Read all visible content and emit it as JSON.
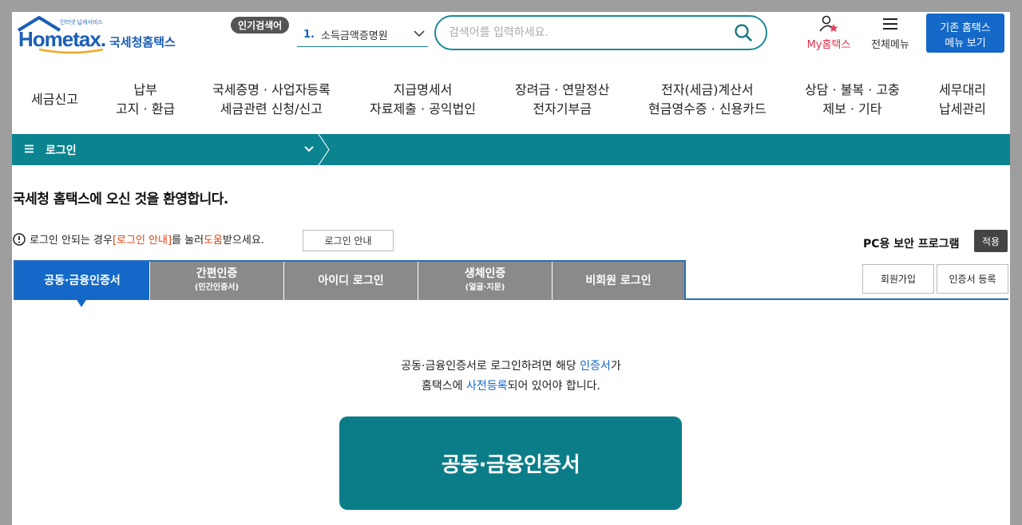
{
  "header": {
    "logo_small": "인터넷 납세서비스",
    "logo_main": "Hometax.",
    "logo_kor": "국세청홈택스",
    "popular_badge": "인기검색어",
    "popular_rank": "1.",
    "popular_term": "소득금액증명원",
    "search_placeholder": "검색어를 입력하세요.",
    "my_hometax": "My홈택스",
    "all_menu": "전체메뉴",
    "old_hometax_line1": "기존 홈택스",
    "old_hometax_line2": "메뉴 보기"
  },
  "gnb": [
    {
      "line1": "세금신고",
      "line2": ""
    },
    {
      "line1": "납부",
      "line2": "고지 · 환급"
    },
    {
      "line1": "국세증명 · 사업자등록",
      "line2": "세금관련 신청/신고"
    },
    {
      "line1": "지급명세서",
      "line2": "자료제출 · 공익법인"
    },
    {
      "line1": "장려금 · 연말정산",
      "line2": "전자기부금"
    },
    {
      "line1": "전자(세금)계산서",
      "line2": "현금영수증 · 신용카드"
    },
    {
      "line1": "상담 · 불복 · 고충",
      "line2": "제보 · 기타"
    },
    {
      "line1": "세무대리",
      "line2": "납세관리"
    }
  ],
  "breadcrumb": {
    "label": "로그인"
  },
  "content": {
    "welcome": "국세청 홈택스에 오신 것을 환영합니다.",
    "notice_pre": "로그인 안되는 경우 ",
    "notice_link": "[로그인 안내]",
    "notice_mid": "를 눌러 ",
    "notice_help": "도움",
    "notice_post": "받으세요.",
    "login_guide_btn": "로그인 안내",
    "pc_security": "PC용 보안 프로그램",
    "apply_btn": "적용",
    "join_btn": "회원가입",
    "cert_reg_btn": "인증서 등록",
    "desc_1a": "공동·금융인증서로 로그인하려면 해당 ",
    "desc_1b": "인증서",
    "desc_1c": "가",
    "desc_2a": "홈택스에 ",
    "desc_2b": "사전등록",
    "desc_2c": "되어 있어야 합니다.",
    "cert_btn": "공동·금융인증서"
  },
  "tabs": [
    {
      "label": "공동·금융인증서",
      "sub": "",
      "active": true
    },
    {
      "label": "간편인증",
      "sub": "(민간인증서)",
      "active": false
    },
    {
      "label": "아이디 로그인",
      "sub": "",
      "active": false
    },
    {
      "label": "생체인증",
      "sub": "(얼굴·지문)",
      "active": false
    },
    {
      "label": "비회원 로그인",
      "sub": "",
      "active": false
    }
  ],
  "colors": {
    "teal": "#0b8490",
    "blue": "#1468c8",
    "tab_gray": "#8a8a8a",
    "red_link": "#d84315"
  }
}
